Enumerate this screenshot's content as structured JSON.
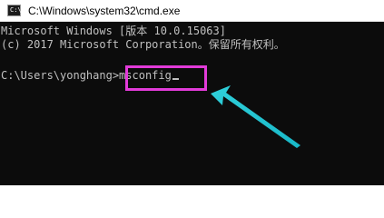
{
  "window": {
    "title": "C:\\Windows\\system32\\cmd.exe",
    "icon": "command-prompt-icon",
    "icon_prompt": "C:\\"
  },
  "console": {
    "lines": [
      "Microsoft Windows [版本 10.0.15063]",
      "(c) 2017 Microsoft Corporation。保留所有权利。"
    ],
    "prompt": "C:\\Users\\yonghang>",
    "command": "msconfig"
  },
  "annotation": {
    "highlight_color": "#e23bd9",
    "arrow_color": "#3ed6dc"
  }
}
